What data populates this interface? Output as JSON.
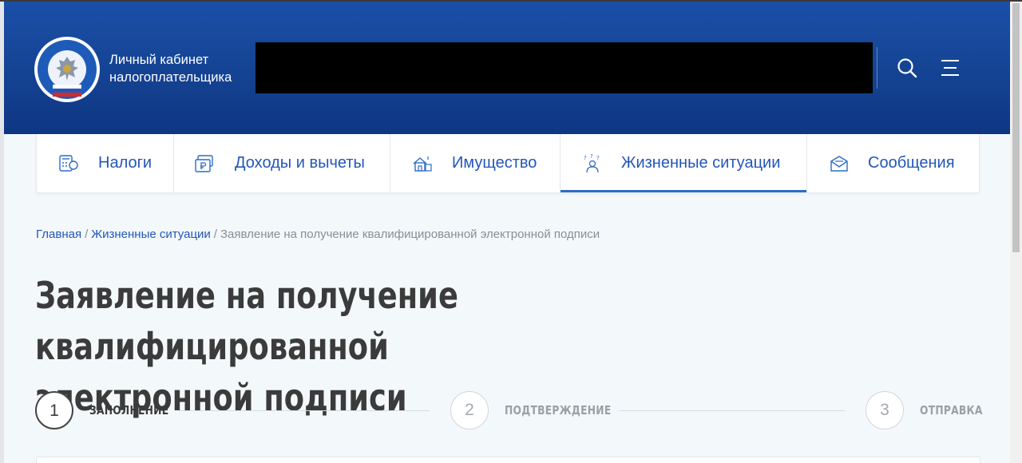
{
  "header": {
    "logo_name": "fns-emblem-logo",
    "title_line1": "Личный кабинет",
    "title_line2": "налогоплательщика"
  },
  "nav": {
    "items": [
      {
        "label": "Налоги",
        "icon": "tax-calculator-icon",
        "active": false
      },
      {
        "label": "Доходы и вычеты",
        "icon": "income-ruble-icon",
        "active": false
      },
      {
        "label": "Имущество",
        "icon": "property-house-icon",
        "active": false
      },
      {
        "label": "Жизненные ситуации",
        "icon": "life-situations-icon",
        "active": true
      },
      {
        "label": "Сообщения",
        "icon": "messages-envelope-icon",
        "active": false
      }
    ]
  },
  "breadcrumb": {
    "home": "Главная",
    "section": "Жизненные ситуации",
    "current": "Заявление на получение квалифицированной электронной подписи",
    "separator": "/"
  },
  "page": {
    "title_line1": "Заявление на получение квалифицированной",
    "title_line2": "электронной подписи"
  },
  "steps": [
    {
      "number": "1",
      "label": "ЗАПОЛНЕНИЕ",
      "state": "current"
    },
    {
      "number": "2",
      "label": "ПОДТВЕРЖДЕНИЕ",
      "state": "pending"
    },
    {
      "number": "3",
      "label": "ОТПРАВКА",
      "state": "pending"
    }
  ],
  "colors": {
    "header_blue": "#164596",
    "link_blue": "#2257b8",
    "active_underline": "#2c6bc8",
    "page_background": "#f3f8fb",
    "title_text": "#3b3b3b"
  }
}
